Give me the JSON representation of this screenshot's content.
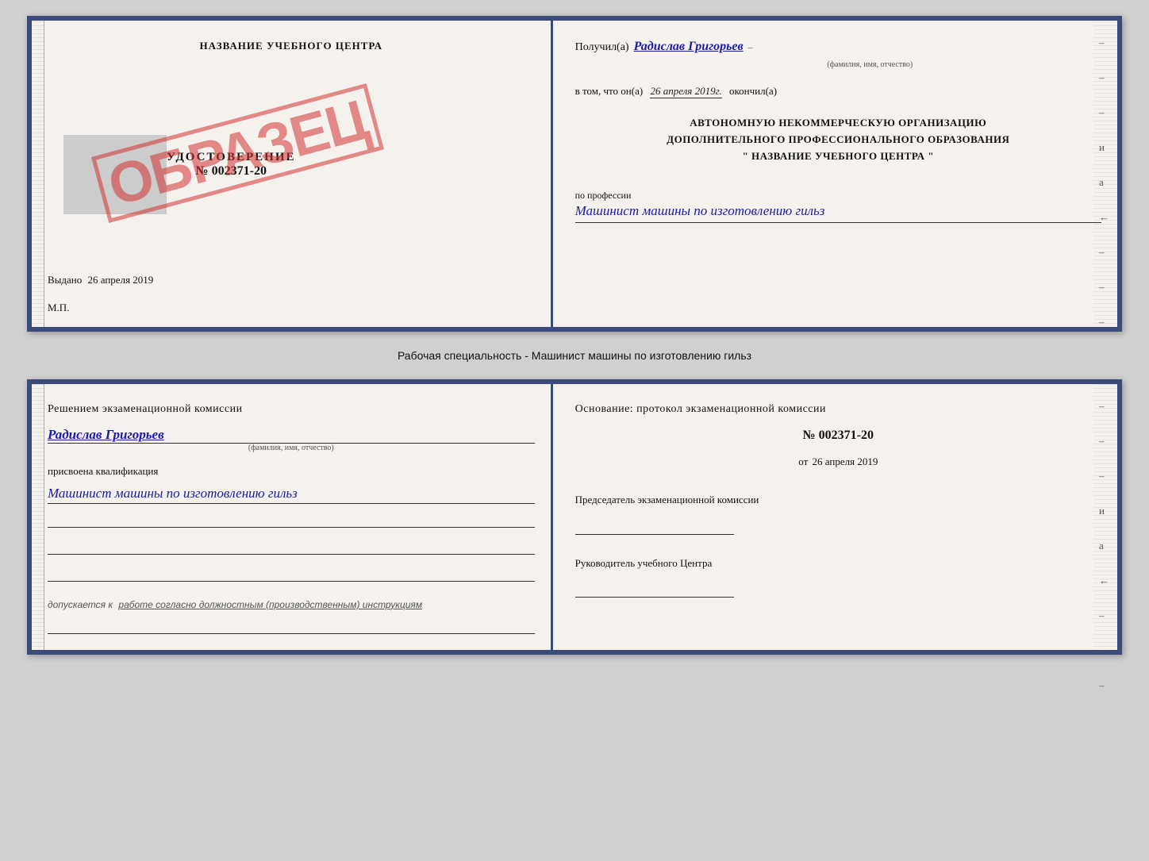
{
  "doc1": {
    "left": {
      "center_title": "НАЗВАНИЕ УЧЕБНОГО ЦЕНТРА",
      "gray_box_placeholder": "",
      "cert_word": "УДОСТОВЕРЕНИЕ",
      "cert_number": "№ 002371-20",
      "stamp_text": "ОБРАЗЕЦ",
      "issued_label": "Выдано",
      "issued_date": "26 апреля 2019",
      "mp_label": "М.П."
    },
    "right": {
      "recipient_prefix": "Получил(а)",
      "recipient_name": "Радислав Григорьев",
      "fio_subtitle": "(фамилия, имя, отчество)",
      "date_prefix": "в том, что он(а)",
      "date_value": "26 апреля 2019г.",
      "date_suffix": "окончил(а)",
      "org_line1": "АВТОНОМНУЮ НЕКОММЕРЧЕСКУЮ ОРГАНИЗАЦИЮ",
      "org_line2": "ДОПОЛНИТЕЛЬНОГО ПРОФЕССИОНАЛЬНОГО ОБРАЗОВАНИЯ",
      "org_line3": "\"   НАЗВАНИЕ УЧЕБНОГО ЦЕНТРА   \"",
      "profession_label": "по профессии",
      "profession_value": "Машинист машины по изготовлению гильз",
      "dashes": [
        "-",
        "-",
        "-",
        "и",
        "а",
        "←",
        "-",
        "-",
        "-"
      ]
    }
  },
  "specialty_label": "Рабочая специальность - Машинист машины по изготовлению гильз",
  "doc2": {
    "left": {
      "decision_text": "Решением  экзаменационной  комиссии",
      "person_name": "Радислав Григорьев",
      "fio_subtitle": "(фамилия, имя, отчество)",
      "assigned_label": "присвоена квалификация",
      "qualification": "Машинист машины по изготовлению гильз",
      "allowed_prefix": "допускается к",
      "allowed_italic": "работе согласно должностным (производственным) инструкциям"
    },
    "right": {
      "basis_label": "Основание:  протокол  экзаменационной  комиссии",
      "protocol_number": "№  002371-20",
      "protocol_date_prefix": "от",
      "protocol_date": "26 апреля 2019",
      "chairman_label": "Председатель экзаменационной комиссии",
      "director_label": "Руководитель учебного Центра",
      "dashes": [
        "-",
        "-",
        "-",
        "и",
        "а",
        "←",
        "-",
        "-",
        "-"
      ]
    }
  }
}
